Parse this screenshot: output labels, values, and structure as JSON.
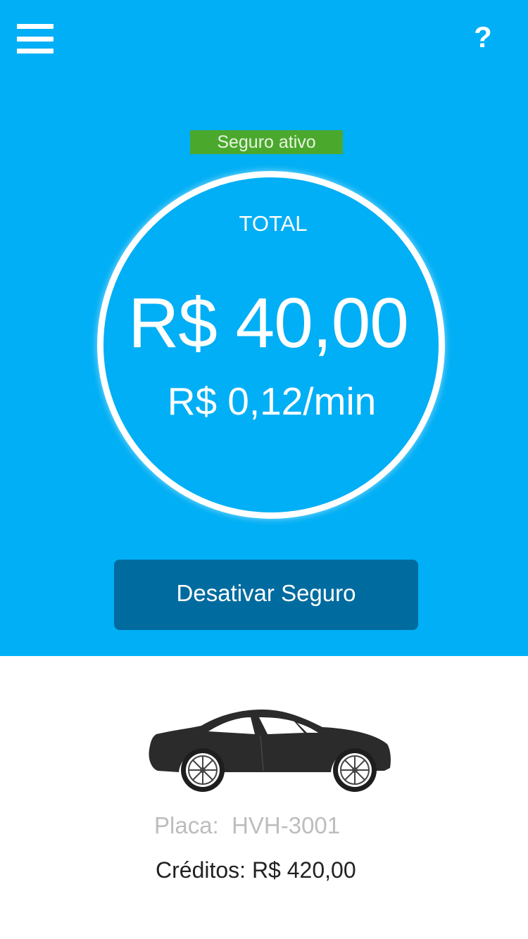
{
  "header": {
    "menu_icon": "hamburger-menu-icon",
    "help_label": "?"
  },
  "status": {
    "badge": "Seguro ativo",
    "badge_color": "#4aa82d"
  },
  "summary": {
    "total_label": "TOTAL",
    "total_value": "R$ 40,00",
    "rate": "R$ 0,12/min"
  },
  "actions": {
    "deactivate_label": "Desativar Seguro"
  },
  "vehicle": {
    "icon": "car-icon",
    "plate_label": "Placa:",
    "plate_value": "HVH-3001",
    "credits_label": "Créditos:",
    "credits_value": "R$ 420,00"
  },
  "colors": {
    "primary": "#00aff5",
    "button": "#006b9f",
    "active": "#4aa82d"
  }
}
